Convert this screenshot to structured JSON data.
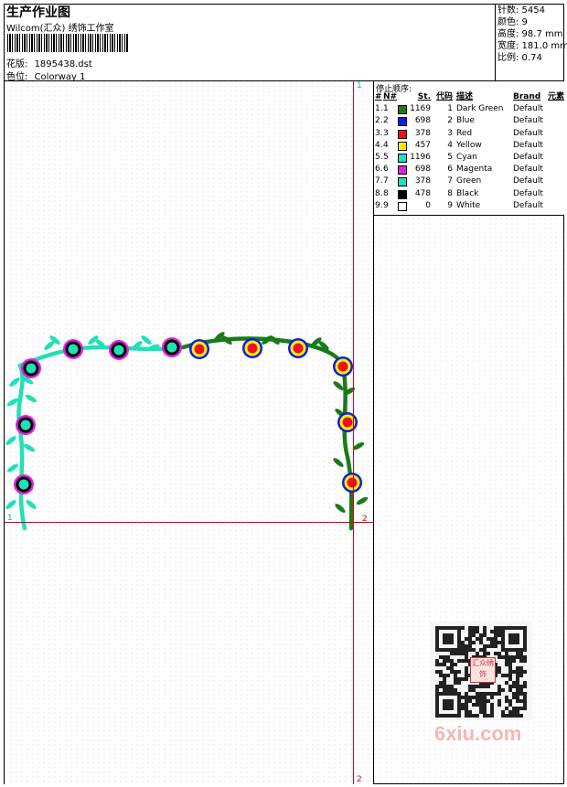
{
  "header": {
    "title": "生产作业图",
    "company": "Wilcom(汇众) 绣饰工作室",
    "pattern_label": "花版:",
    "pattern_value": "1895438.dst",
    "colorway_label": "色位:",
    "colorway_value": "Colorway 1"
  },
  "info": {
    "stitches": "针数: 5454",
    "colors": "颜色: 9",
    "height": "高度: 98.7 mm",
    "width": "宽度: 181.0 mm",
    "scale": "比例: 0.74"
  },
  "legend": {
    "heading": "停止顺序:",
    "columns": [
      "#",
      "N#",
      "St.",
      "代码",
      "描述",
      "Brand",
      "元素"
    ],
    "rows": [
      {
        "idx": "1.",
        "n": "1",
        "st": "1169",
        "code": "1",
        "desc": "Dark Green",
        "brand": "Default",
        "color": "#1a7a1a"
      },
      {
        "idx": "2.",
        "n": "2",
        "st": "698",
        "code": "2",
        "desc": "Blue",
        "brand": "Default",
        "color": "#0a1ee6"
      },
      {
        "idx": "3.",
        "n": "3",
        "st": "378",
        "code": "3",
        "desc": "Red",
        "brand": "Default",
        "color": "#ee1111"
      },
      {
        "idx": "4.",
        "n": "4",
        "st": "457",
        "code": "4",
        "desc": "Yellow",
        "brand": "Default",
        "color": "#ffee00"
      },
      {
        "idx": "5.",
        "n": "5",
        "st": "1196",
        "code": "5",
        "desc": "Cyan",
        "brand": "Default",
        "color": "#22e0b8"
      },
      {
        "idx": "6.",
        "n": "6",
        "st": "698",
        "code": "6",
        "desc": "Magenta",
        "brand": "Default",
        "color": "#e020e0"
      },
      {
        "idx": "7.",
        "n": "7",
        "st": "378",
        "code": "7",
        "desc": "Green",
        "brand": "Default",
        "color": "#22e0b8"
      },
      {
        "idx": "8.",
        "n": "8",
        "st": "478",
        "code": "8",
        "desc": "Black",
        "brand": "Default",
        "color": "#000000"
      },
      {
        "idx": "9.",
        "n": "9",
        "st": "0",
        "code": "9",
        "desc": "White",
        "brand": "Default",
        "color": "#ffffff"
      }
    ]
  },
  "markers": {
    "top_right": "1",
    "left": "1",
    "right": "2",
    "bottom": "2"
  },
  "qr": {
    "logo_text": "汇众绣饰"
  },
  "watermark": "6xiu.com"
}
